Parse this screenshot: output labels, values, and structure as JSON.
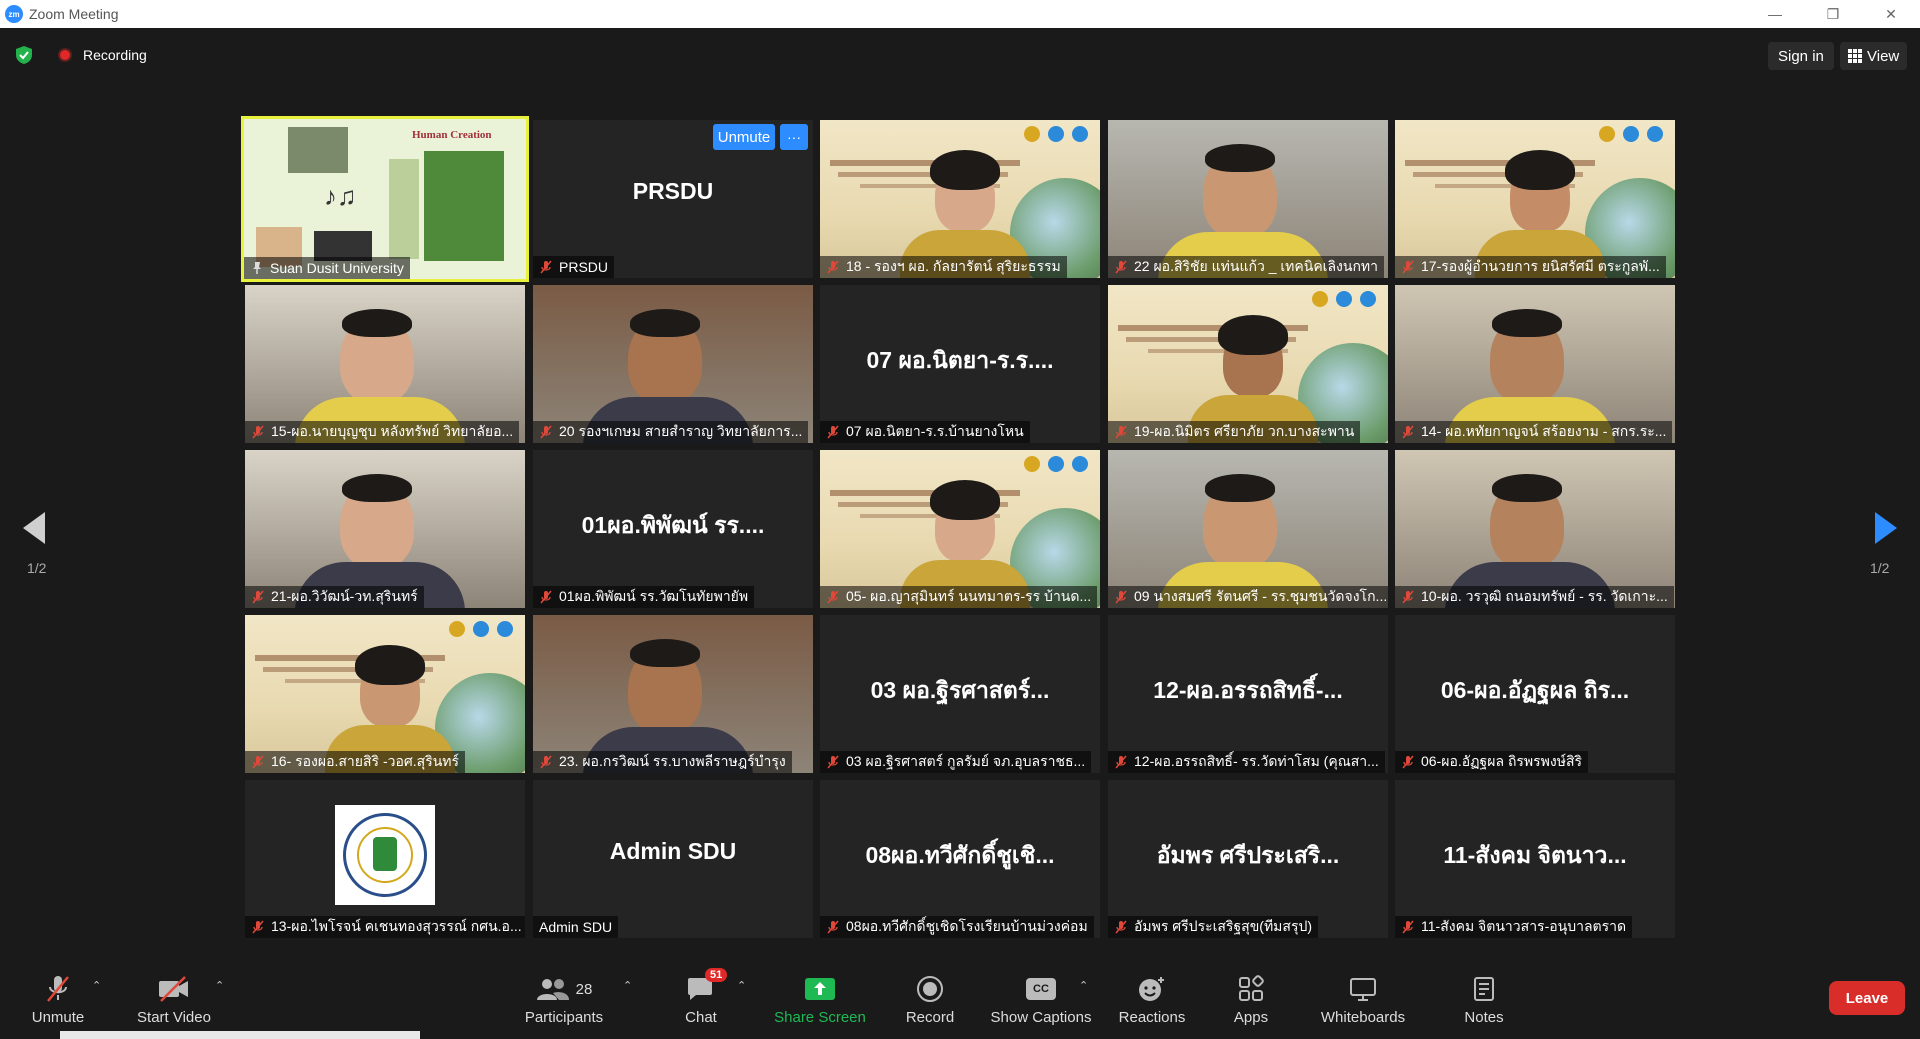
{
  "window": {
    "app_logo": "zm",
    "title": "Zoom Meeting",
    "controls": [
      "—",
      "❐",
      "✕"
    ]
  },
  "topbar": {
    "recording_label": "Recording",
    "signin_label": "Sign in",
    "view_label": "View"
  },
  "active_speaker_overlay": {
    "unmute_label": "Unmute",
    "more_label": "···"
  },
  "pagination": {
    "left_label": "1/2",
    "right_label": "1/2"
  },
  "tiles": [
    {
      "name": "Suan Dusit University",
      "big": "",
      "kind": "slide",
      "slide_title": "Human Creation"
    },
    {
      "name": "PRSDU",
      "big": "PRSDU",
      "kind": "text"
    },
    {
      "name": "18 - รองฯ ผอ. กัลยารัตน์ สุริยะธรรม",
      "big": "",
      "kind": "poster"
    },
    {
      "name": "22 ผอ.สิริชัย แท่นแก้ว _ เทคนิคเลิงนกทา",
      "big": "",
      "kind": "room"
    },
    {
      "name": "17-รองผู้อำนวยการ ยนิสรัศมี ตระกูลพั...",
      "big": "",
      "kind": "poster"
    },
    {
      "name": "15-ผอ.นายบุญชุบ หลังทรัพย์ วิทยาลัยอ...",
      "big": "",
      "kind": "room"
    },
    {
      "name": "20 รองฯเกษม สายสำราญ วิทยาลัยการ...",
      "big": "",
      "kind": "room"
    },
    {
      "name": "07 ผอ.นิตยา-ร.ร.บ้านยางโหน",
      "big": "07 ผอ.นิตยา-ร.ร....",
      "kind": "text"
    },
    {
      "name": "19-ผอ.นิมิตร ศรียาภัย วก.บางสะพาน",
      "big": "",
      "kind": "poster"
    },
    {
      "name": "14- ผอ.หทัยกาญจน์ สร้อยงาม - สกร.ระ...",
      "big": "",
      "kind": "room"
    },
    {
      "name": "21-ผอ.วิวัฒน์-วท.สุรินทร์",
      "big": "",
      "kind": "room"
    },
    {
      "name": "01ผอ.พิพัฒน์ รร.วัฒโนทัยพายัพ",
      "big": "01ผอ.พิพัฒน์ รร....",
      "kind": "text"
    },
    {
      "name": "05- ผอ.ญาสุมินทร์ นนทมาตร-รร บ้านด...",
      "big": "",
      "kind": "poster"
    },
    {
      "name": "09 นางสมศรี รัตนศรี - รร.ชุมชนวัดจงโก...",
      "big": "",
      "kind": "room"
    },
    {
      "name": "10-ผอ. วรวุฒิ ถนอมทรัพย์ - รร. วัดเกาะ...",
      "big": "",
      "kind": "room"
    },
    {
      "name": "16- รองผอ.สายสิริ -วอศ.สุรินทร์",
      "big": "",
      "kind": "poster"
    },
    {
      "name": "23. ผอ.กรวิฒน์ รร.บางพลีราษฎร์บำรุง",
      "big": "",
      "kind": "room"
    },
    {
      "name": "03 ผอ.ฐิรศาสตร์ กูลรัมย์ จภ.อุบลราชธ...",
      "big": "03 ผอ.ฐิรศาสตร์...",
      "kind": "text"
    },
    {
      "name": "12-ผอ.อรรถสิทธิ์- รร.วัดท่าโสม (คุณสา...",
      "big": "12-ผอ.อรรถสิทธิ์-...",
      "kind": "text"
    },
    {
      "name": "06-ผอ.อัฏฐผล ถิรพรพงษ์สิริ",
      "big": "06-ผอ.อัฏฐผล ถิร...",
      "kind": "text"
    },
    {
      "name": "13-ผอ.ไพโรจน์ คเชนทองสุวรรณ์ กศน.อ...",
      "big": "",
      "kind": "emblem"
    },
    {
      "name": "Admin SDU",
      "big": "Admin SDU",
      "kind": "text"
    },
    {
      "name": "08ผอ.ทวีศักดิ์ชูเชิดโรงเรียนบ้านม่วงค่อม",
      "big": "08ผอ.ทวีศักดิ์ชูเชิ...",
      "kind": "text"
    },
    {
      "name": "อัมพร ศรีประเสริฐสุข(ทีมสรุป)",
      "big": "อัมพร ศรีประเสริ...",
      "kind": "text"
    },
    {
      "name": "11-สังคม จิตนาวสาร-อนุบาลตราด",
      "big": "11-สังคม จิตนาว...",
      "kind": "text"
    }
  ],
  "toolbar": {
    "unmute": "Unmute",
    "start_video": "Start Video",
    "participants": "Participants",
    "participants_count": "28",
    "chat": "Chat",
    "chat_badge": "51",
    "share_screen": "Share Screen",
    "record": "Record",
    "show_captions": "Show Captions",
    "captions_icon_text": "CC",
    "reactions": "Reactions",
    "apps": "Apps",
    "whiteboards": "Whiteboards",
    "notes": "Notes",
    "leave": "Leave"
  },
  "colors": {
    "accent": "#2d8cff",
    "share_green": "#1fb954",
    "leave_red": "#d92d2a",
    "active_border": "#e9f23b",
    "mic_muted": "#e0483a"
  }
}
